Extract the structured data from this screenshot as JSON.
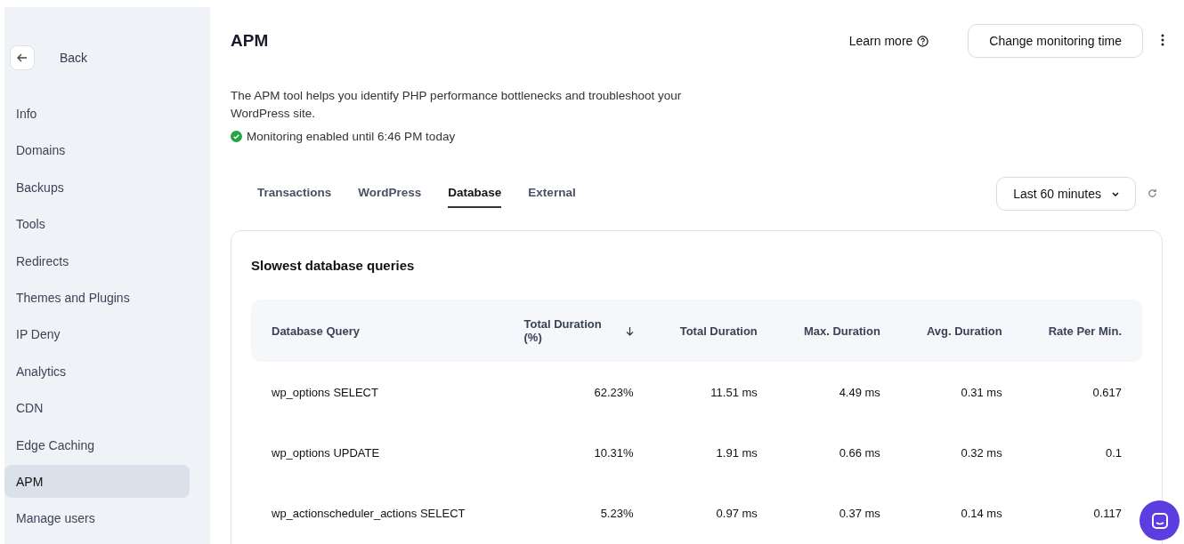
{
  "sidebar": {
    "back_label": "Back",
    "items": [
      {
        "label": "Info",
        "selected": false
      },
      {
        "label": "Domains",
        "selected": false
      },
      {
        "label": "Backups",
        "selected": false
      },
      {
        "label": "Tools",
        "selected": false
      },
      {
        "label": "Redirects",
        "selected": false
      },
      {
        "label": "Themes and Plugins",
        "selected": false
      },
      {
        "label": "IP Deny",
        "selected": false
      },
      {
        "label": "Analytics",
        "selected": false
      },
      {
        "label": "CDN",
        "selected": false
      },
      {
        "label": "Edge Caching",
        "selected": false
      },
      {
        "label": "APM",
        "selected": true
      },
      {
        "label": "Manage users",
        "selected": false
      }
    ]
  },
  "header": {
    "title": "APM",
    "learn_more": "Learn more",
    "button": "Change monitoring time"
  },
  "description": "The APM tool helps you identify PHP performance bottlenecks and troubleshoot your WordPress site.",
  "status": {
    "text": "Monitoring enabled until 6:46 PM today",
    "enabled": true
  },
  "tabs": [
    {
      "label": "Transactions",
      "selected": false
    },
    {
      "label": "WordPress",
      "selected": false
    },
    {
      "label": "Database",
      "selected": true
    },
    {
      "label": "External",
      "selected": false
    }
  ],
  "time_range": "Last 60 minutes",
  "card": {
    "title": "Slowest database queries",
    "table": {
      "columns": [
        {
          "label": "Database Query",
          "sorted": false
        },
        {
          "label": "Total Duration (%)",
          "sorted": true
        },
        {
          "label": "Total Duration",
          "sorted": false
        },
        {
          "label": "Max. Duration",
          "sorted": false
        },
        {
          "label": "Avg. Duration",
          "sorted": false
        },
        {
          "label": "Rate Per Min.",
          "sorted": false
        }
      ],
      "rows": [
        [
          "wp_options SELECT",
          "62.23%",
          "11.51 ms",
          "4.49 ms",
          "0.31 ms",
          "0.617"
        ],
        [
          "wp_options UPDATE",
          "10.31%",
          "1.91 ms",
          "0.66 ms",
          "0.32 ms",
          "0.1"
        ],
        [
          "wp_actionscheduler_actions SELECT",
          "5.23%",
          "0.97 ms",
          "0.37 ms",
          "0.14 ms",
          "0.117"
        ]
      ]
    }
  }
}
